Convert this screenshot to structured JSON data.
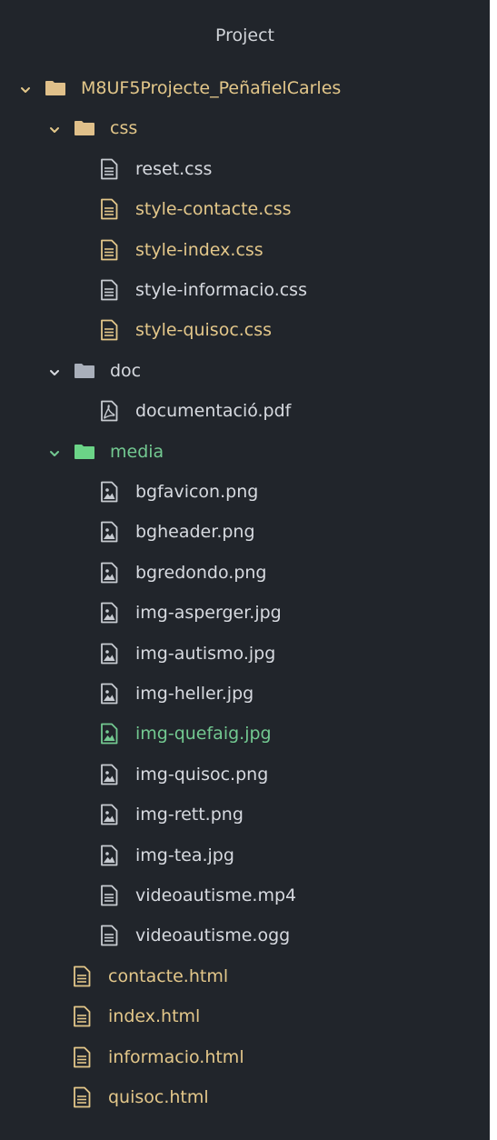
{
  "panel": {
    "title": "Project"
  },
  "colors": {
    "background": "#21252b",
    "text": "#d7dae0",
    "modified": "#e3c78a",
    "added": "#73c991",
    "folder_yellow": "#e0c08a",
    "folder_gray": "#a9afba",
    "folder_green": "#6bd487",
    "icon_gray": "#c7cbd1"
  },
  "tree": [
    {
      "label": "M8UF5Projecte_PeñafielCarles",
      "type": "folder",
      "level": 0,
      "expanded": true,
      "status": "modified",
      "icon": "folder-icon"
    },
    {
      "label": "css",
      "type": "folder",
      "level": 1,
      "expanded": true,
      "status": "modified",
      "icon": "folder-icon"
    },
    {
      "label": "reset.css",
      "type": "file",
      "level": 2,
      "status": "normal",
      "icon": "file-text-icon"
    },
    {
      "label": "style-contacte.css",
      "type": "file",
      "level": 2,
      "status": "modified",
      "icon": "file-text-icon"
    },
    {
      "label": "style-index.css",
      "type": "file",
      "level": 2,
      "status": "modified",
      "icon": "file-text-icon"
    },
    {
      "label": "style-informacio.css",
      "type": "file",
      "level": 2,
      "status": "normal",
      "icon": "file-text-icon"
    },
    {
      "label": "style-quisoc.css",
      "type": "file",
      "level": 2,
      "status": "modified",
      "icon": "file-text-icon"
    },
    {
      "label": "doc",
      "type": "folder",
      "level": 1,
      "expanded": true,
      "status": "normal",
      "icon": "folder-icon"
    },
    {
      "label": "documentació.pdf",
      "type": "file",
      "level": 2,
      "status": "normal",
      "icon": "file-pdf-icon"
    },
    {
      "label": "media",
      "type": "folder",
      "level": 1,
      "expanded": true,
      "status": "added",
      "icon": "folder-icon"
    },
    {
      "label": "bgfavicon.png",
      "type": "file",
      "level": 2,
      "status": "normal",
      "icon": "file-image-icon"
    },
    {
      "label": "bgheader.png",
      "type": "file",
      "level": 2,
      "status": "normal",
      "icon": "file-image-icon"
    },
    {
      "label": "bgredondo.png",
      "type": "file",
      "level": 2,
      "status": "normal",
      "icon": "file-image-icon"
    },
    {
      "label": "img-asperger.jpg",
      "type": "file",
      "level": 2,
      "status": "normal",
      "icon": "file-image-icon"
    },
    {
      "label": "img-autismo.jpg",
      "type": "file",
      "level": 2,
      "status": "normal",
      "icon": "file-image-icon"
    },
    {
      "label": "img-heller.jpg",
      "type": "file",
      "level": 2,
      "status": "normal",
      "icon": "file-image-icon"
    },
    {
      "label": "img-quefaig.jpg",
      "type": "file",
      "level": 2,
      "status": "added",
      "icon": "file-image-icon"
    },
    {
      "label": "img-quisoc.png",
      "type": "file",
      "level": 2,
      "status": "normal",
      "icon": "file-image-icon"
    },
    {
      "label": "img-rett.png",
      "type": "file",
      "level": 2,
      "status": "normal",
      "icon": "file-image-icon"
    },
    {
      "label": "img-tea.jpg",
      "type": "file",
      "level": 2,
      "status": "normal",
      "icon": "file-image-icon"
    },
    {
      "label": "videoautisme.mp4",
      "type": "file",
      "level": 2,
      "status": "normal",
      "icon": "file-text-icon"
    },
    {
      "label": "videoautisme.ogg",
      "type": "file",
      "level": 2,
      "status": "normal",
      "icon": "file-text-icon"
    },
    {
      "label": "contacte.html",
      "type": "file",
      "level": 1,
      "status": "modified",
      "icon": "file-text-icon"
    },
    {
      "label": "index.html",
      "type": "file",
      "level": 1,
      "status": "modified",
      "icon": "file-text-icon"
    },
    {
      "label": "informacio.html",
      "type": "file",
      "level": 1,
      "status": "modified",
      "icon": "file-text-icon"
    },
    {
      "label": "quisoc.html",
      "type": "file",
      "level": 1,
      "status": "modified",
      "icon": "file-text-icon"
    }
  ]
}
